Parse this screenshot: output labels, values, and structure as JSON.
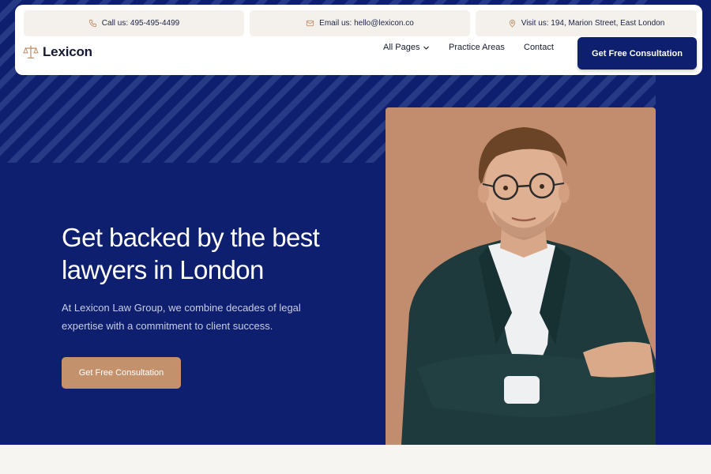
{
  "topbar": {
    "phone": "Call us: 495-495-4499",
    "email": "Email us: hello@lexicon.co",
    "address": "Visit us: 194, Marion Street, East London"
  },
  "brand": {
    "name": "Lexicon",
    "icon": "scales-icon"
  },
  "nav": {
    "items": [
      "All Pages",
      "Practice Areas",
      "Contact"
    ],
    "cta": "Get Free Consultation"
  },
  "hero": {
    "headline_line1": "Get backed by the best",
    "headline_line2": "lawyers in London",
    "subtext_line1": "At Lexicon Law Group, we combine decades of legal",
    "subtext_line2": "expertise with a commitment to client success.",
    "cta": "Get Free Consultation"
  },
  "colors": {
    "navy": "#0d1f6e",
    "accent": "#c3916c",
    "photo_bg": "#c18d6e",
    "pill_bg": "#f4f1ec"
  }
}
